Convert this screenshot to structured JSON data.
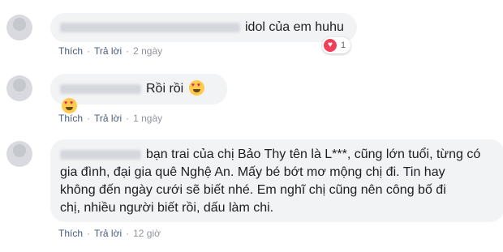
{
  "comments": [
    {
      "text": "idol của em huhu",
      "actions": {
        "like": "Thích",
        "reply": "Trả lời",
        "time": "2 ngày"
      },
      "reaction": {
        "icon": "heart-icon",
        "count": "1"
      }
    },
    {
      "text": "Rồi rồi",
      "emoji": [
        "heart-eyes-emoji",
        "heart-eyes-emoji"
      ],
      "actions": {
        "like": "Thích",
        "reply": "Trả lời",
        "time": "1 ngày"
      }
    },
    {
      "lines": [
        "bạn trai của chị Bảo Thy tên là L***, cũng lớn tuổi, từng có",
        "gia đình, đại gia quê Nghệ An. Mấy bé bớt mơ mộng chị đi. Tin hay",
        "không đến ngày cưới sẽ biết nhé. Em nghĩ chị cũng nên công bố đi",
        "chị, nhiều người biết rồi, dấu làm chi."
      ],
      "actions": {
        "like": "Thích",
        "reply": "Trả lời",
        "time": "12 giờ"
      }
    }
  ],
  "colors": {
    "bubble": "#f2f3f5",
    "link": "#4a5c7b",
    "heart": "#f33e58"
  }
}
